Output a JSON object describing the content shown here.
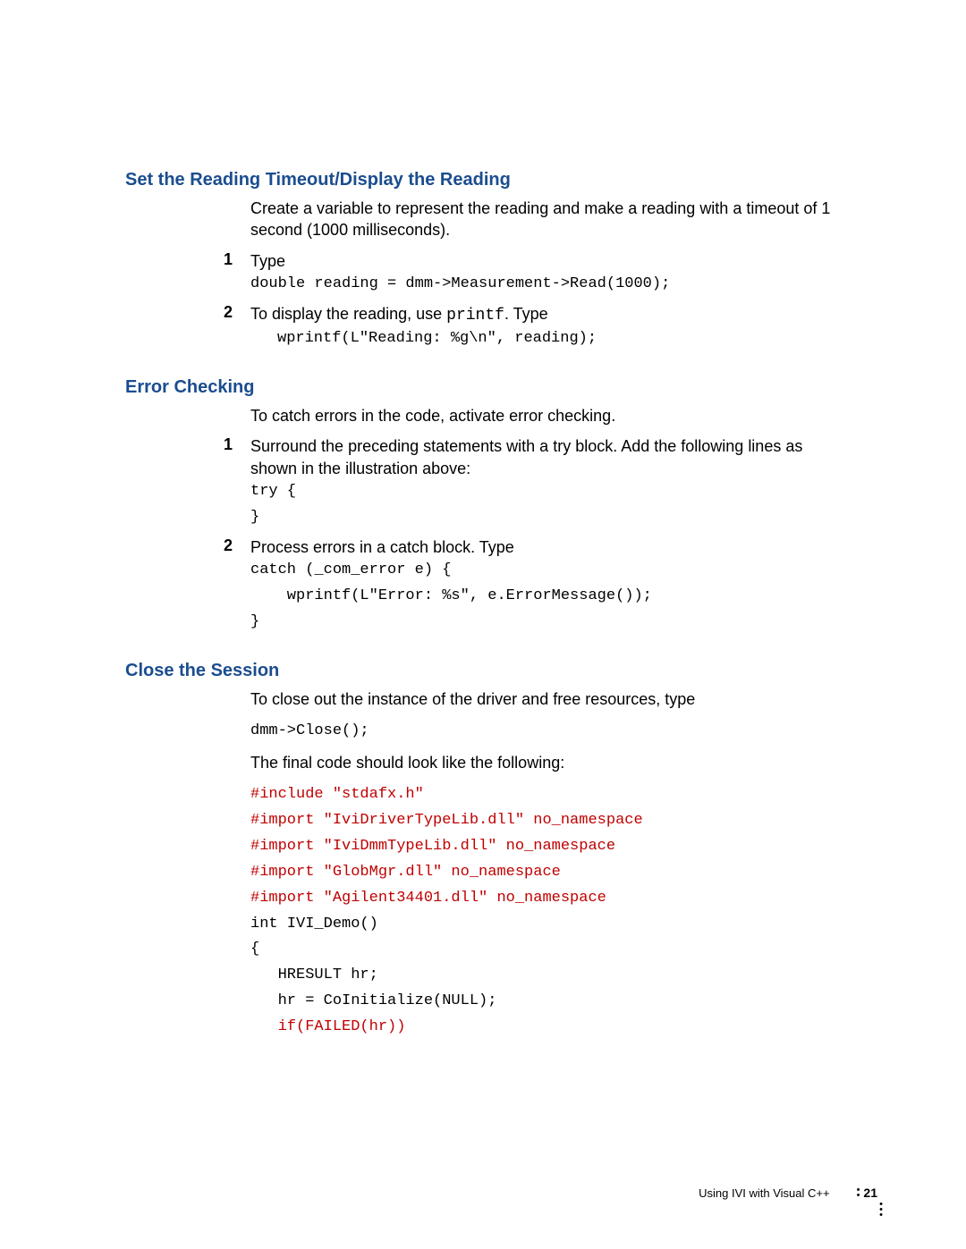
{
  "section1": {
    "heading": "Set the Reading Timeout/Display the Reading",
    "intro": "Create a variable to represent the reading and make a reading with a timeout of 1 second (1000 milliseconds).",
    "step1_num": "1",
    "step1_text": "Type",
    "step1_code": "double reading = dmm->Measurement->Read(1000);",
    "step2_num": "2",
    "step2_text_a": "To display the reading, use ",
    "step2_text_code": "printf",
    "step2_text_b": ". Type",
    "step2_code": "wprintf(L\"Reading: %g\\n\", reading);"
  },
  "section2": {
    "heading": "Error Checking",
    "intro": "To catch errors in the code, activate error checking.",
    "step1_num": "1",
    "step1_text": "Surround the preceding statements with a try block. Add the following lines as shown in the illustration above:",
    "step1_code_a": "try {",
    "step1_code_b": "",
    "step1_code_c": "}",
    "step2_num": "2",
    "step2_text": "Process errors in a catch block. Type",
    "step2_code_a": "catch (_com_error e) {",
    "step2_code_b": "    wprintf(L\"Error: %s\", e.ErrorMessage());",
    "step2_code_c": "}"
  },
  "section3": {
    "heading": "Close the Session",
    "intro": "To close out the instance of the driver and free resources, type",
    "code1": "dmm->Close();",
    "text2": "The final code should look like the following:",
    "red1": "#include \"stdafx.h\"",
    "red2": "#import \"IviDriverTypeLib.dll\" no_namespace",
    "red3": "#import \"IviDmmTypeLib.dll\" no_namespace",
    "red4": "#import \"GlobMgr.dll\" no_namespace",
    "red5": "#import \"Agilent34401.dll\" no_namespace",
    "black1": "int IVI_Demo()",
    "black2": "{",
    "black3": "   HRESULT hr;",
    "black4": "   hr = CoInitialize(NULL);",
    "red6": "   if(FAILED(hr))"
  },
  "footer": {
    "text": "Using IVI with Visual C++",
    "page": "21"
  }
}
